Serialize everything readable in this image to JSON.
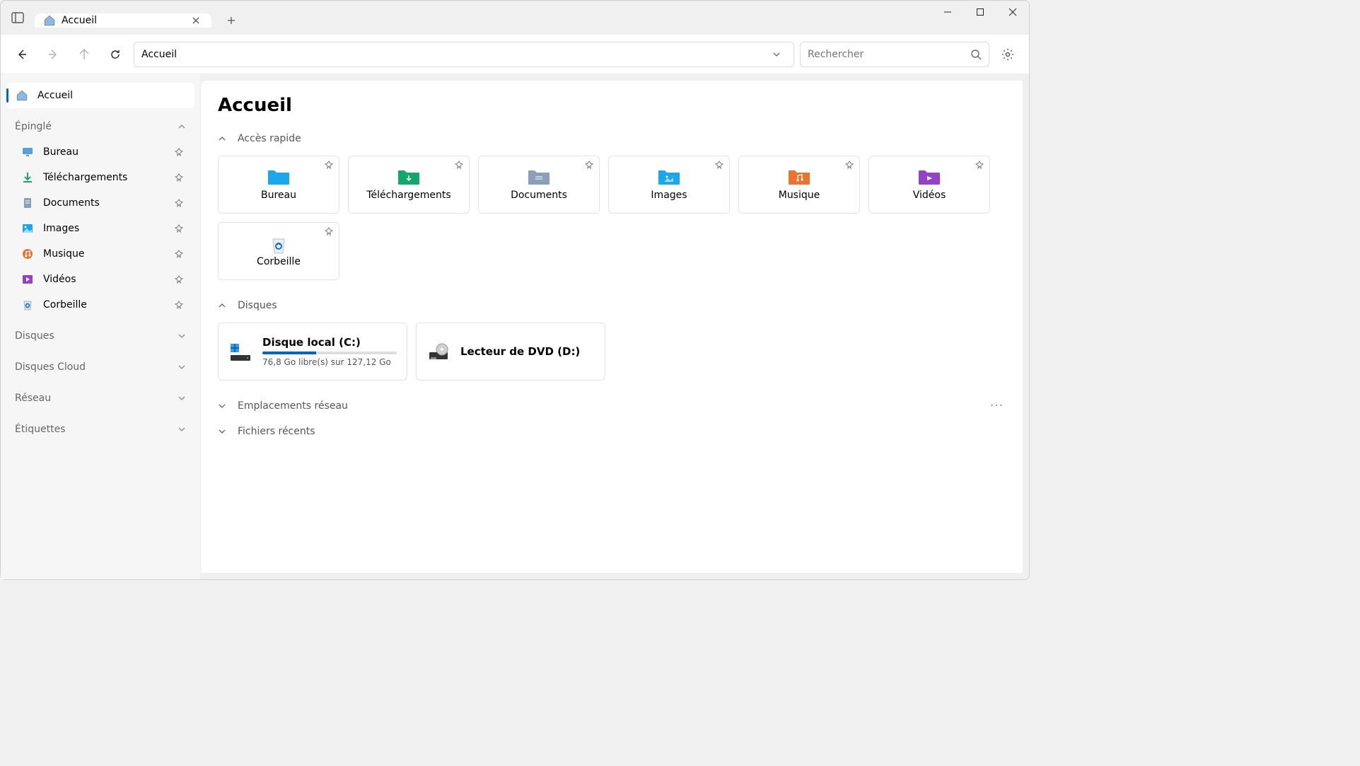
{
  "titlebar": {
    "tab_title": "Accueil"
  },
  "toolbar": {
    "address": "Accueil",
    "search_placeholder": "Rechercher"
  },
  "sidebar": {
    "home": "Accueil",
    "pinned_header": "Épinglé",
    "pinned": [
      {
        "label": "Bureau",
        "icon": "desktop"
      },
      {
        "label": "Téléchargements",
        "icon": "downloads"
      },
      {
        "label": "Documents",
        "icon": "documents"
      },
      {
        "label": "Images",
        "icon": "images"
      },
      {
        "label": "Musique",
        "icon": "music"
      },
      {
        "label": "Vidéos",
        "icon": "videos"
      },
      {
        "label": "Corbeille",
        "icon": "recycle"
      }
    ],
    "sections": [
      {
        "label": "Disques"
      },
      {
        "label": "Disques Cloud"
      },
      {
        "label": "Réseau"
      },
      {
        "label": "Étiquettes"
      }
    ]
  },
  "main": {
    "title": "Accueil",
    "quick_access_header": "Accès rapide",
    "quick_access": [
      {
        "label": "Bureau",
        "color": "#1aa7ec"
      },
      {
        "label": "Téléchargements",
        "color": "#13a869"
      },
      {
        "label": "Documents",
        "color": "#8aa0b8"
      },
      {
        "label": "Images",
        "color": "#1aa7ec"
      },
      {
        "label": "Musique",
        "color": "#e97432"
      },
      {
        "label": "Vidéos",
        "color": "#9642c6"
      },
      {
        "label": "Corbeille",
        "color": "#cfd8e0"
      }
    ],
    "drives_header": "Disques",
    "drives": [
      {
        "title": "Disque local (C:)",
        "subtitle": "76,8 Go libre(s) sur 127,12 Go",
        "fill_percent": 40,
        "type": "hdd"
      },
      {
        "title": "Lecteur de DVD (D:)",
        "subtitle": "",
        "fill_percent": null,
        "type": "dvd"
      }
    ],
    "network_header": "Emplacements réseau",
    "recent_header": "Fichiers récents"
  }
}
